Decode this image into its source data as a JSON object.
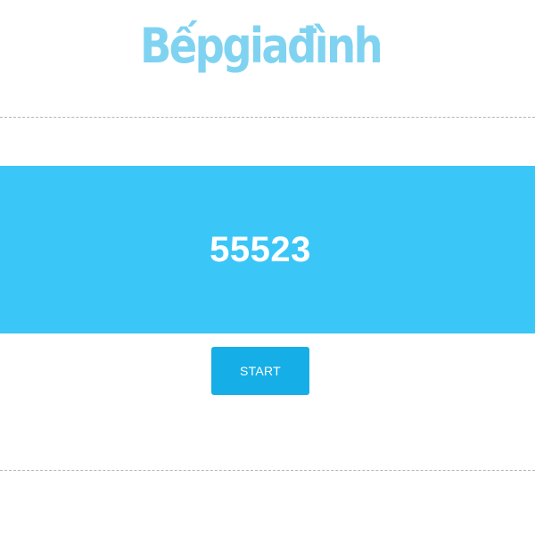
{
  "header": {
    "logo_text": "Bếpgiađình"
  },
  "banner": {
    "counter_value": "55523"
  },
  "actions": {
    "start_label": "START"
  },
  "colors": {
    "logo": "#7fd3f1",
    "banner": "#3bc6f8",
    "button": "#16aee6",
    "divider": "#b5b5b5"
  }
}
